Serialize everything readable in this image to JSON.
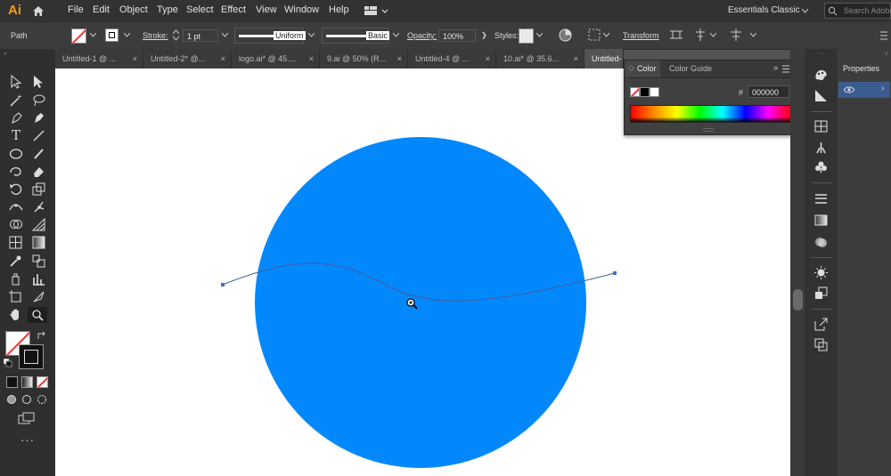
{
  "app": {
    "logo": "Ai",
    "home_icon": "home-icon"
  },
  "menu": [
    "File",
    "Edit",
    "Object",
    "Type",
    "Select",
    "Effect",
    "View",
    "Window",
    "Help"
  ],
  "workspace": {
    "label": "Essentials Classic",
    "search_placeholder": "Search Adobe"
  },
  "control": {
    "selection_label": "Path",
    "stroke_label": "Stroke:",
    "stroke_weight": "1 pt",
    "profile_label": "Uniform",
    "brush_label": "Basic",
    "opacity_label": "Opacity:",
    "opacity_value": "100%",
    "styles_label": "Styles:",
    "transform_label": "Transform"
  },
  "tabs": [
    {
      "label": "Untitled-1 @ ..."
    },
    {
      "label": "Untitled-2* @..."
    },
    {
      "label": "logo.ai* @ 45...."
    },
    {
      "label": "9.ai @ 50% (R..."
    },
    {
      "label": "Untitled-4 @ ..."
    },
    {
      "label": "10.ai* @ 35.6..."
    },
    {
      "label": "Untitled-"
    }
  ],
  "color_panel": {
    "tab_color": "Color",
    "tab_color_guide": "Color Guide",
    "hex_symbol": "#",
    "hex_value": "000000"
  },
  "properties_panel": {
    "title": "Properties"
  },
  "colors": {
    "circle_fill": "#0388fb",
    "path_stroke": "#3f5fa0",
    "canvas": "#ffffff",
    "panel_bg": "#404040"
  }
}
